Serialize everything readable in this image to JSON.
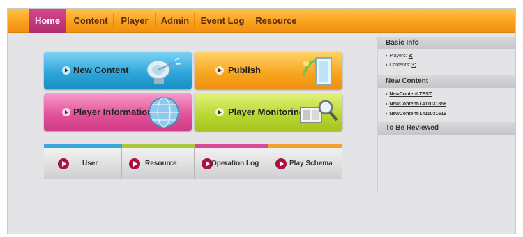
{
  "nav": {
    "tabs": [
      {
        "label": "Home"
      },
      {
        "label": "Content"
      },
      {
        "label": "Player"
      },
      {
        "label": "Admin"
      },
      {
        "label": "Event Log"
      },
      {
        "label": "Resource"
      }
    ],
    "active": "Home"
  },
  "tiles": {
    "new_content": "New Content",
    "publish": "Publish",
    "player_information": "Player Information",
    "player_monitoring": "Player Monitoring"
  },
  "buttons": {
    "user": "User",
    "resource": "Resource",
    "operation_log": "Operation Log",
    "play_schema": "Play Schema"
  },
  "side_panel": {
    "basic_info": {
      "title": "Basic Info",
      "players_label": "Players:",
      "players_value": "3;",
      "contents_label": "Contents:",
      "contents_value": "3;"
    },
    "new_content": {
      "title": "New Content",
      "items": [
        "NewContent.TEST",
        "NewContent-1411031858",
        "NewContent-1411031619"
      ]
    },
    "to_be_reviewed": {
      "title": "To Be Reviewed"
    }
  },
  "colors": {
    "nav_bar": "#f9a11c",
    "nav_active": "#c23a7e",
    "tile_blue": "#2aa4d8",
    "tile_orange": "#f7a41d",
    "tile_pink": "#e04f97",
    "tile_green": "#b8d531",
    "button_icon": "#a8143e"
  },
  "icons": {
    "new_content": "satellite-dish-icon",
    "publish": "publish-doors-icon",
    "player_information": "globe-icon",
    "player_monitoring": "monitor-magnifier-icon",
    "button": "play-circle-icon"
  }
}
